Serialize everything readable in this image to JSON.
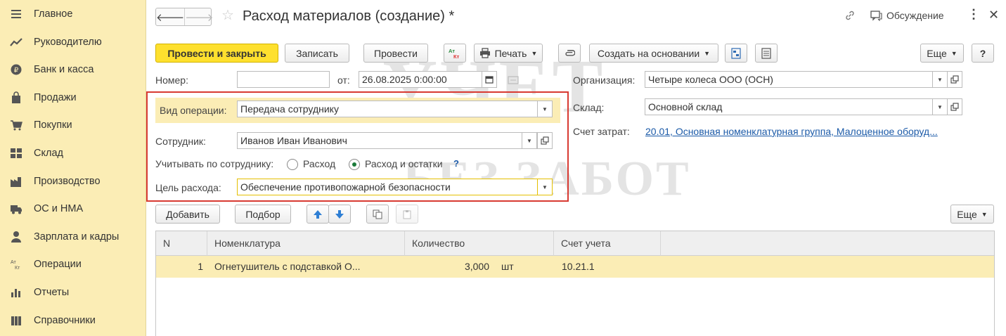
{
  "sidebar": {
    "items": [
      {
        "label": "Главное",
        "icon": "menu-icon"
      },
      {
        "label": "Руководителю",
        "icon": "trend-icon"
      },
      {
        "label": "Банк и касса",
        "icon": "coin-icon"
      },
      {
        "label": "Продажи",
        "icon": "bag-icon"
      },
      {
        "label": "Покупки",
        "icon": "cart-icon"
      },
      {
        "label": "Склад",
        "icon": "grid-icon"
      },
      {
        "label": "Производство",
        "icon": "factory-icon"
      },
      {
        "label": "ОС и НМА",
        "icon": "truck-icon"
      },
      {
        "label": "Зарплата и кадры",
        "icon": "person-icon"
      },
      {
        "label": "Операции",
        "icon": "dt-kt-icon"
      },
      {
        "label": "Отчеты",
        "icon": "bar-chart-icon"
      },
      {
        "label": "Справочники",
        "icon": "books-icon"
      }
    ]
  },
  "header": {
    "title": "Расход материалов (создание) *",
    "discussion": "Обсуждение"
  },
  "toolbar": {
    "post_close": "Провести и закрыть",
    "save": "Записать",
    "post": "Провести",
    "print": "Печать",
    "create_based": "Создать на основании",
    "more": "Еще"
  },
  "form": {
    "number_label": "Номер:",
    "number_value": "",
    "from_label": "от:",
    "date_value": "26.08.2025  0:00:00",
    "org_label": "Организация:",
    "org_value": "Четыре колеса ООО (ОСН)",
    "warehouse_label": "Склад:",
    "warehouse_value": "Основной склад",
    "cost_label": "Счет затрат:",
    "cost_value": "20.01, Основная номенклатурная группа, Малоценное оборуд...",
    "op_label": "Вид операции:",
    "op_value": "Передача сотруднику",
    "employee_label": "Сотрудник:",
    "employee_value": "Иванов Иван Иванович",
    "account_by_label": "Учитывать по сотруднику:",
    "radio_expense": "Расход",
    "radio_expense_balance": "Расход и остатки",
    "help": "?",
    "purpose_label": "Цель расхода:",
    "purpose_value": "Обеспечение противопожарной безопасности"
  },
  "table_toolbar": {
    "add": "Добавить",
    "pick": "Подбор",
    "more": "Еще"
  },
  "table": {
    "columns": [
      "N",
      "Номенклатура",
      "Количество",
      "Счет учета"
    ],
    "rows": [
      {
        "n": "1",
        "item": "Огнетушитель с подставкой О...",
        "qty": "3,000",
        "unit": "шт",
        "account": "10.21.1"
      }
    ]
  },
  "watermark": {
    "line1": "УЧЕТ",
    "line2": "БЕЗ ЗАБОТ"
  }
}
